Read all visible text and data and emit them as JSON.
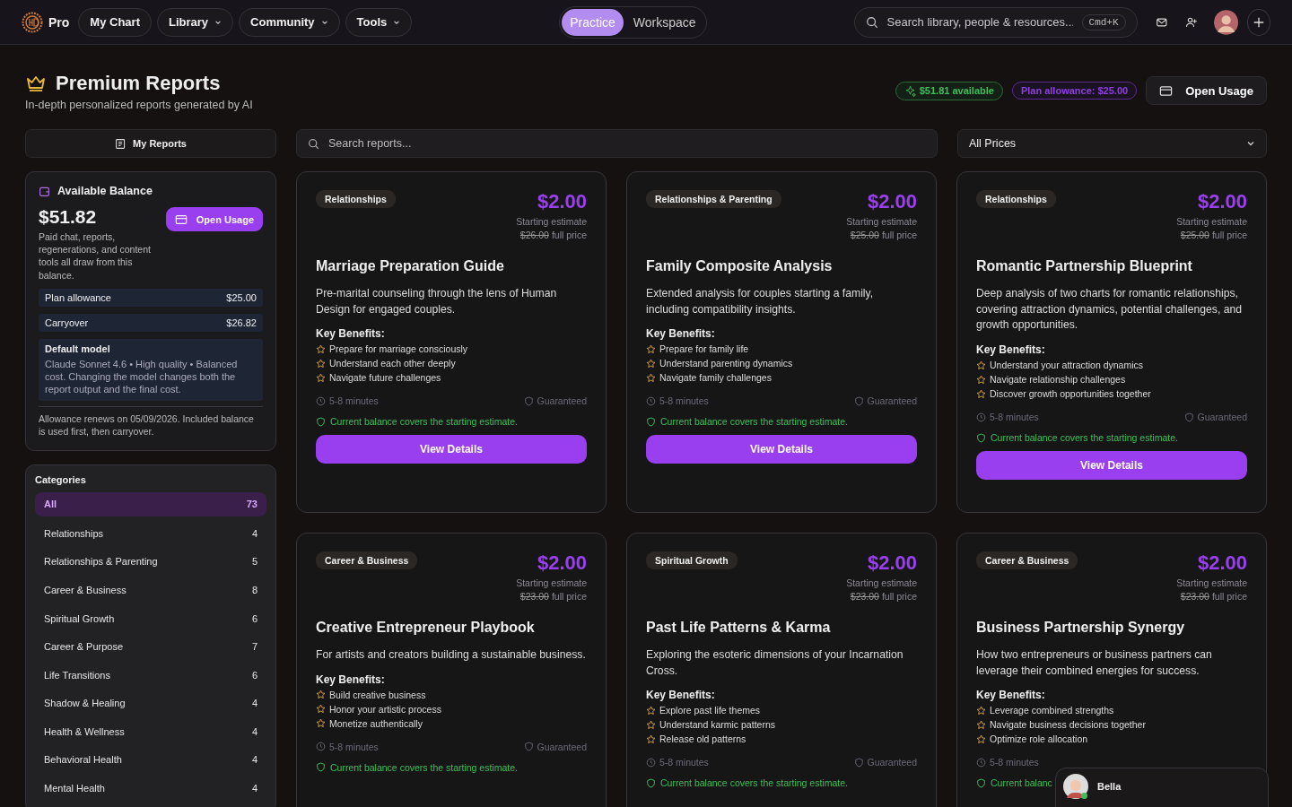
{
  "nav": {
    "brand": "Pro",
    "links": [
      {
        "label": "My Chart",
        "kind": "link"
      },
      {
        "label": "Library",
        "kind": "dropdown"
      },
      {
        "label": "Community",
        "kind": "dropdown"
      },
      {
        "label": "Tools",
        "kind": "dropdown"
      }
    ],
    "modes": [
      {
        "label": "Practice",
        "selected": true
      },
      {
        "label": "Workspace",
        "selected": false
      }
    ],
    "search": {
      "placeholder": "Search library, people & resources...",
      "shortcut": "Cmd+K"
    }
  },
  "header": {
    "title": "Premium Reports",
    "subtitle": "In-depth personalized reports generated by AI",
    "available": "$51.81 available",
    "allowance": "Plan allowance: $25.00",
    "usage_button": "Open Usage"
  },
  "filters": {
    "my_reports": "My Reports",
    "search_placeholder": "Search reports...",
    "price_filter": "All Prices"
  },
  "balance": {
    "title": "Available Balance",
    "amount": "$51.82",
    "button": "Open Usage",
    "description": "Paid chat, reports, regenerations, and content tools all draw from this balance.",
    "rows": [
      {
        "label": "Plan allowance",
        "value": "$25.00"
      },
      {
        "label": "Carryover",
        "value": "$26.82"
      }
    ],
    "model_title": "Default model",
    "model_text": "Claude Sonnet 4.6 • High quality • Balanced cost. Changing the model changes both the report output and the final cost.",
    "note": "Allowance renews on 05/09/2026. Included balance is used first, then carryover."
  },
  "categories": {
    "title": "Categories",
    "items": [
      {
        "label": "All",
        "count": "73",
        "selected": true
      },
      {
        "label": "Relationships",
        "count": "4",
        "selected": false
      },
      {
        "label": "Relationships & Parenting",
        "count": "5",
        "selected": false
      },
      {
        "label": "Career & Business",
        "count": "8",
        "selected": false
      },
      {
        "label": "Spiritual Growth",
        "count": "6",
        "selected": false
      },
      {
        "label": "Career & Purpose",
        "count": "7",
        "selected": false
      },
      {
        "label": "Life Transitions",
        "count": "6",
        "selected": false
      },
      {
        "label": "Shadow & Healing",
        "count": "4",
        "selected": false
      },
      {
        "label": "Health & Wellness",
        "count": "4",
        "selected": false
      },
      {
        "label": "Behavioral Health",
        "count": "4",
        "selected": false
      },
      {
        "label": "Mental Health",
        "count": "4",
        "selected": false
      }
    ]
  },
  "reports": [
    {
      "tag": "Relationships",
      "price": "$2.00",
      "price_label": "Starting estimate",
      "full_price": "$26.00",
      "full_price_label": "full price",
      "title": "Marriage Preparation Guide",
      "description": "Pre-marital counseling through the lens of Human Design for engaged couples.",
      "benefits_title": "Key Benefits:",
      "benefits": [
        "Prepare for marriage consciously",
        "Understand each other deeply",
        "Navigate future challenges"
      ],
      "duration": "5-8 minutes",
      "guarantee": "Guaranteed",
      "status": "Current balance covers the starting estimate.",
      "button": "View Details"
    },
    {
      "tag": "Relationships & Parenting",
      "price": "$2.00",
      "price_label": "Starting estimate",
      "full_price": "$25.00",
      "full_price_label": "full price",
      "title": "Family Composite Analysis",
      "description": "Extended analysis for couples starting a family, including compatibility insights.",
      "benefits_title": "Key Benefits:",
      "benefits": [
        "Prepare for family life",
        "Understand parenting dynamics",
        "Navigate family challenges"
      ],
      "duration": "5-8 minutes",
      "guarantee": "Guaranteed",
      "status": "Current balance covers the starting estimate.",
      "button": "View Details"
    },
    {
      "tag": "Relationships",
      "price": "$2.00",
      "price_label": "Starting estimate",
      "full_price": "$25.00",
      "full_price_label": "full price",
      "title": "Romantic Partnership Blueprint",
      "description": "Deep analysis of two charts for romantic relationships, covering attraction dynamics, potential challenges, and growth opportunities.",
      "benefits_title": "Key Benefits:",
      "benefits": [
        "Understand your attraction dynamics",
        "Navigate relationship challenges",
        "Discover growth opportunities together"
      ],
      "duration": "5-8 minutes",
      "guarantee": "Guaranteed",
      "status": "Current balance covers the starting estimate.",
      "button": "View Details"
    },
    {
      "tag": "Career & Business",
      "price": "$2.00",
      "price_label": "Starting estimate",
      "full_price": "$23.00",
      "full_price_label": "full price",
      "title": "Creative Entrepreneur Playbook",
      "description": "For artists and creators building a sustainable business.",
      "benefits_title": "Key Benefits:",
      "benefits": [
        "Build creative business",
        "Honor your artistic process",
        "Monetize authentically"
      ],
      "duration": "5-8 minutes",
      "guarantee": "Guaranteed",
      "status": "Current balance covers the starting estimate."
    },
    {
      "tag": "Spiritual Growth",
      "price": "$2.00",
      "price_label": "Starting estimate",
      "full_price": "$23.00",
      "full_price_label": "full price",
      "title": "Past Life Patterns & Karma",
      "description": "Exploring the esoteric dimensions of your Incarnation Cross.",
      "benefits_title": "Key Benefits:",
      "benefits": [
        "Explore past life themes",
        "Understand karmic patterns",
        "Release old patterns"
      ],
      "duration": "5-8 minutes",
      "guarantee": "Guaranteed",
      "status": "Current balance covers the starting estimate."
    },
    {
      "tag": "Career & Business",
      "price": "$2.00",
      "price_label": "Starting estimate",
      "full_price": "$23.00",
      "full_price_label": "full price",
      "title": "Business Partnership Synergy",
      "description": "How two entrepreneurs or business partners can leverage their combined energies for success.",
      "benefits_title": "Key Benefits:",
      "benefits": [
        "Leverage combined strengths",
        "Navigate business decisions together",
        "Optimize role allocation"
      ],
      "duration": "5-8 minutes",
      "status": "Current balanc"
    }
  ],
  "chat": {
    "name": "Bella",
    "online": true
  }
}
